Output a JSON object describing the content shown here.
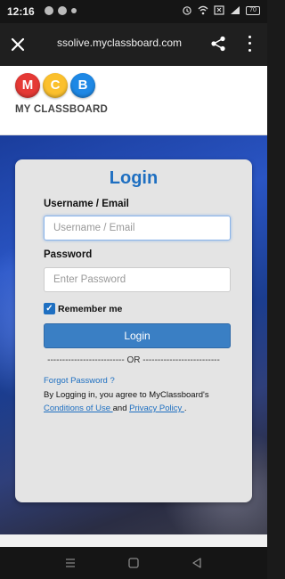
{
  "status_bar": {
    "time": "12:16",
    "battery": "70"
  },
  "browser": {
    "url": "ssolive.myclassboard.com"
  },
  "logo": {
    "letters": [
      "M",
      "C",
      "B"
    ],
    "colors": [
      "#e53935",
      "#fbc02d",
      "#1e88e5"
    ],
    "text": "MY CLASSBOARD"
  },
  "login": {
    "title": "Login",
    "username_label": "Username / Email",
    "username_placeholder": "Username / Email",
    "password_label": "Password",
    "password_placeholder": "Enter Password",
    "remember_label": "Remember me",
    "remember_checked": true,
    "button_label": "Login",
    "or_divider": "-------------------------- OR --------------------------",
    "forgot_password": "Forgot Password ?",
    "agree_prefix": "By Logging in, you agree to MyClassboard's",
    "terms_link": "Conditions of Use ",
    "and_text": "and",
    "privacy_link": "Privacy Policy ",
    "agree_suffix": "."
  },
  "icons": {
    "close": "close-icon",
    "share": "share-icon",
    "menu": "more-vert-icon",
    "nav_menu": "menu-icon",
    "nav_home": "home-icon",
    "nav_back": "back-icon"
  }
}
